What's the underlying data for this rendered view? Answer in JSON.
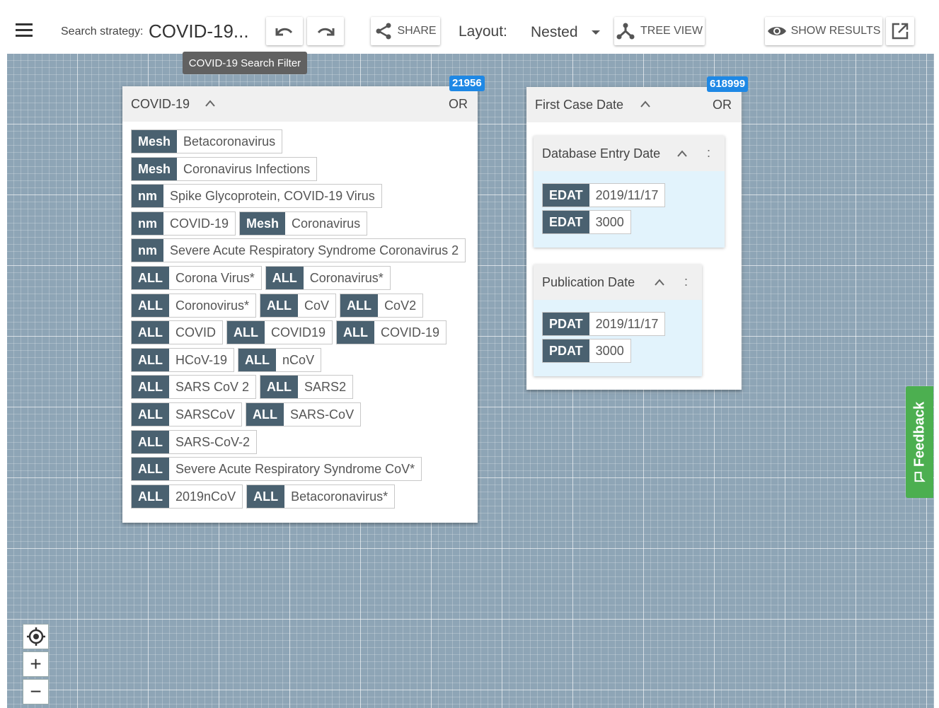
{
  "toolbar": {
    "strategy_label": "Search strategy:",
    "strategy_value": "COVID-19...",
    "share_label": "SHARE",
    "layout_label": "Layout:",
    "layout_value": "Nested",
    "tree_view_label": "TREE VIEW",
    "show_results_label": "SHOW RESULTS",
    "tooltip": "COVID-19 Search Filter"
  },
  "colors": {
    "canvas": "#8ea5b6",
    "tag_kind": "#4a6170",
    "badge": "#1e88e5",
    "subcard_bg": "#e2f3fc",
    "feedback": "#4caf50"
  },
  "covid_card": {
    "title": "COVID-19",
    "operator": "OR",
    "count": "21956",
    "rows": [
      [
        {
          "kind": "Mesh",
          "term": "Betacoronavirus"
        }
      ],
      [
        {
          "kind": "Mesh",
          "term": "Coronavirus Infections"
        }
      ],
      [
        {
          "kind": "nm",
          "term": "Spike Glycoprotein, COVID-19 Virus"
        }
      ],
      [
        {
          "kind": "nm",
          "term": "COVID-19"
        },
        {
          "kind": "Mesh",
          "term": "Coronavirus"
        }
      ],
      [
        {
          "kind": "nm",
          "term": "Severe Acute Respiratory Syndrome Coronavirus 2"
        }
      ],
      [
        {
          "kind": "ALL",
          "term": "Corona Virus*"
        },
        {
          "kind": "ALL",
          "term": "Coronavirus*"
        }
      ],
      [
        {
          "kind": "ALL",
          "term": "Coronovirus*"
        },
        {
          "kind": "ALL",
          "term": "CoV"
        },
        {
          "kind": "ALL",
          "term": "CoV2"
        }
      ],
      [
        {
          "kind": "ALL",
          "term": "COVID"
        },
        {
          "kind": "ALL",
          "term": "COVID19"
        },
        {
          "kind": "ALL",
          "term": "COVID-19"
        }
      ],
      [
        {
          "kind": "ALL",
          "term": "HCoV-19"
        },
        {
          "kind": "ALL",
          "term": "nCoV"
        }
      ],
      [
        {
          "kind": "ALL",
          "term": "SARS CoV 2"
        },
        {
          "kind": "ALL",
          "term": "SARS2"
        }
      ],
      [
        {
          "kind": "ALL",
          "term": "SARSCoV"
        },
        {
          "kind": "ALL",
          "term": "SARS-CoV"
        }
      ],
      [
        {
          "kind": "ALL",
          "term": "SARS-CoV-2"
        }
      ],
      [
        {
          "kind": "ALL",
          "term": "Severe Acute Respiratory Syndrome CoV*"
        }
      ],
      [
        {
          "kind": "ALL",
          "term": "2019nCoV"
        },
        {
          "kind": "ALL",
          "term": "Betacoronavirus*"
        }
      ]
    ]
  },
  "date_card": {
    "title": "First Case Date",
    "operator": "OR",
    "count": "618999",
    "more_label": ":",
    "groups": [
      {
        "title": "Database Entry Date",
        "tags": [
          {
            "kind": "EDAT",
            "term": "2019/11/17"
          },
          {
            "kind": "EDAT",
            "term": "3000"
          }
        ]
      },
      {
        "title": "Publication Date",
        "tags": [
          {
            "kind": "PDAT",
            "term": "2019/11/17"
          },
          {
            "kind": "PDAT",
            "term": "3000"
          }
        ]
      }
    ]
  },
  "feedback": {
    "label": "Feedback"
  },
  "zoom": {
    "plus": "+",
    "minus": "−"
  }
}
